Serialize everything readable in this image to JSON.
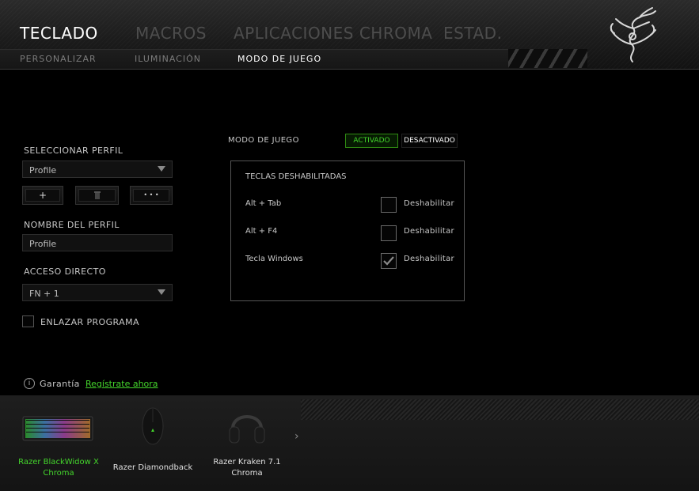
{
  "header": {
    "tabs": [
      {
        "label": "TECLADO",
        "active": true
      },
      {
        "label": "MACROS",
        "active": false
      },
      {
        "label": "APLICACIONES CHROMA",
        "active": false
      },
      {
        "label": "ESTAD.",
        "active": false
      }
    ],
    "subtabs": [
      {
        "label": "PERSONALIZAR",
        "active": false
      },
      {
        "label": "ILUMINACIÓN",
        "active": false
      },
      {
        "label": "MODO DE JUEGO",
        "active": true
      }
    ],
    "logo_icon": "razer-snake-icon"
  },
  "profile": {
    "select_label": "SELECCIONAR PERFIL",
    "selected": "Profile",
    "add_label": "+",
    "delete_icon": "trash-icon",
    "more_label": "• • •",
    "name_label": "NOMBRE DEL PERFIL",
    "name_value": "Profile",
    "shortcut_label": "ACCESO DIRECTO",
    "shortcut_value": "FN + 1",
    "link_program_label": "ENLAZAR PROGRAMA",
    "link_program_checked": false
  },
  "game_mode": {
    "label": "MODO DE JUEGO",
    "on_label": "ACTIVADO",
    "off_label": "DESACTIVADO",
    "state": "on",
    "panel_title": "TECLAS DESHABILITADAS",
    "rows": [
      {
        "key": "Alt + Tab",
        "action": "Deshabilitar",
        "checked": false
      },
      {
        "key": "Alt + F4",
        "action": "Deshabilitar",
        "checked": false
      },
      {
        "key": "Tecla Windows",
        "action": "Deshabilitar",
        "checked": true
      }
    ]
  },
  "warranty": {
    "label": "Garantía",
    "link": "Regístrate ahora"
  },
  "devices": [
    {
      "line1": "Razer BlackWidow X",
      "line2": "Chroma",
      "active": true
    },
    {
      "line1": "Razer Diamondback",
      "line2": "",
      "active": false
    },
    {
      "line1": "Razer Kraken 7.1",
      "line2": "Chroma",
      "active": false
    }
  ],
  "colors": {
    "accent": "#44d62c",
    "background": "#000000"
  }
}
